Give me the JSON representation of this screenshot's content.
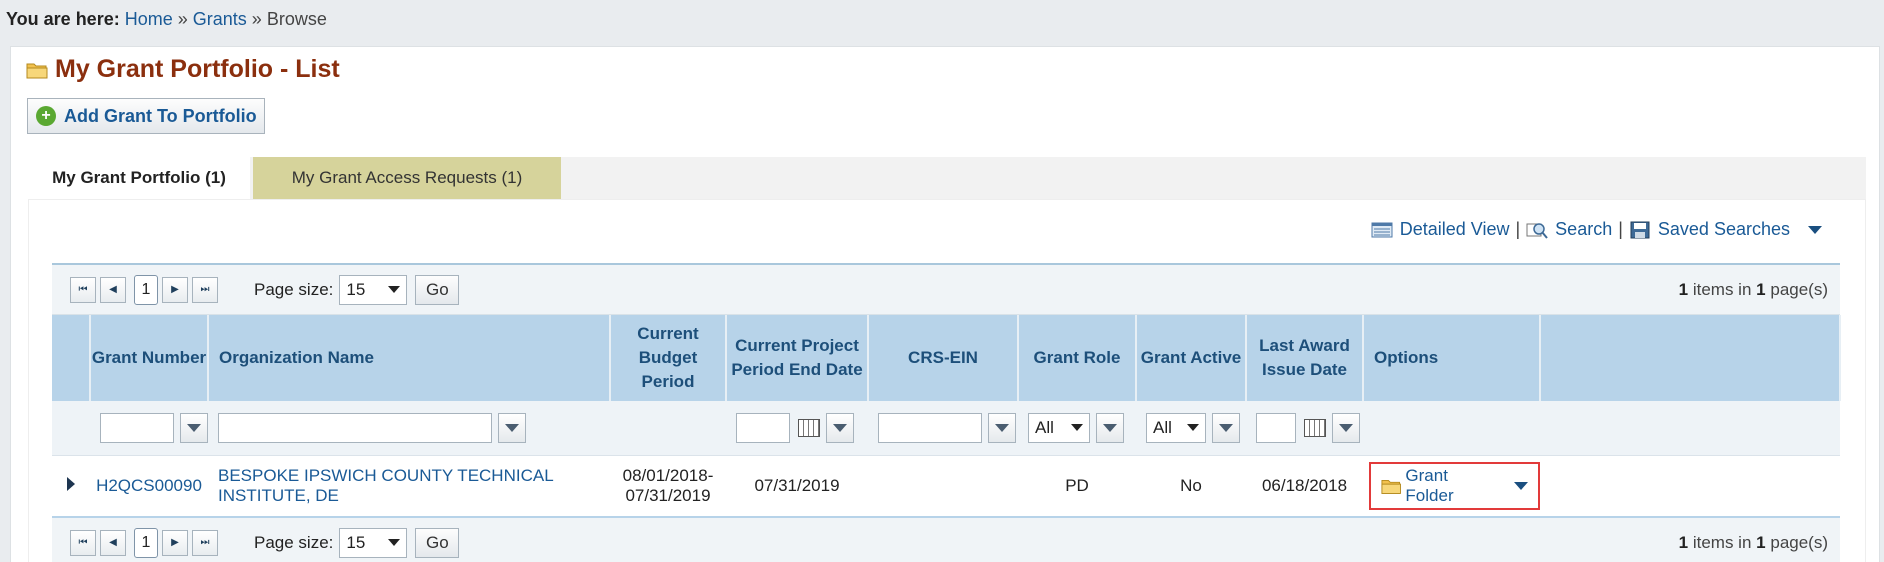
{
  "breadcrumb": {
    "prefix": "You are here:",
    "home": "Home",
    "grants": "Grants",
    "current": "Browse",
    "separator": "»"
  },
  "page_title": "My Grant Portfolio - List",
  "add_button": "Add Grant To Portfolio",
  "tabs": [
    {
      "label": "My Grant Portfolio (1)",
      "active": true
    },
    {
      "label": "My Grant Access Requests (1)",
      "active": false
    }
  ],
  "toolbar": {
    "detailed_view": "Detailed View",
    "search": "Search",
    "saved_searches": "Saved Searches",
    "divider": "|"
  },
  "pager": {
    "current_page": "1",
    "page_size_label": "Page size:",
    "page_size": "15",
    "go": "Go",
    "items_count": "1",
    "items_text": "items in",
    "pages_count": "1",
    "pages_text": "page(s)"
  },
  "columns": {
    "grant_number": "Grant Number",
    "organization_name": "Organization Name",
    "current_budget_period": "Current Budget Period",
    "current_project_period_end_date": "Current Project Period End Date",
    "crs_ein": "CRS-EIN",
    "grant_role": "Grant Role",
    "grant_active": "Grant Active",
    "last_award_issue_date": "Last Award Issue Date",
    "options": "Options"
  },
  "filters": {
    "grant_role": "All",
    "grant_active": "All"
  },
  "row": {
    "grant_number": "H2QCS00090",
    "organization_name": "BESPOKE IPSWICH COUNTY TECHNICAL INSTITUTE, DE",
    "budget_period_start": "08/01/2018-",
    "budget_period_end": "07/31/2019",
    "project_period_end": "07/31/2019",
    "crs_ein": "",
    "grant_role": "PD",
    "grant_active": "No",
    "last_award_issue_date": "06/18/2018",
    "option_label": "Grant Folder"
  },
  "colors": {
    "title": "#8b2f0e",
    "link": "#1a5a96",
    "header_bg": "#b7d3e9",
    "highlight_border": "#e23a3a",
    "inactive_tab": "#d6d39b"
  }
}
